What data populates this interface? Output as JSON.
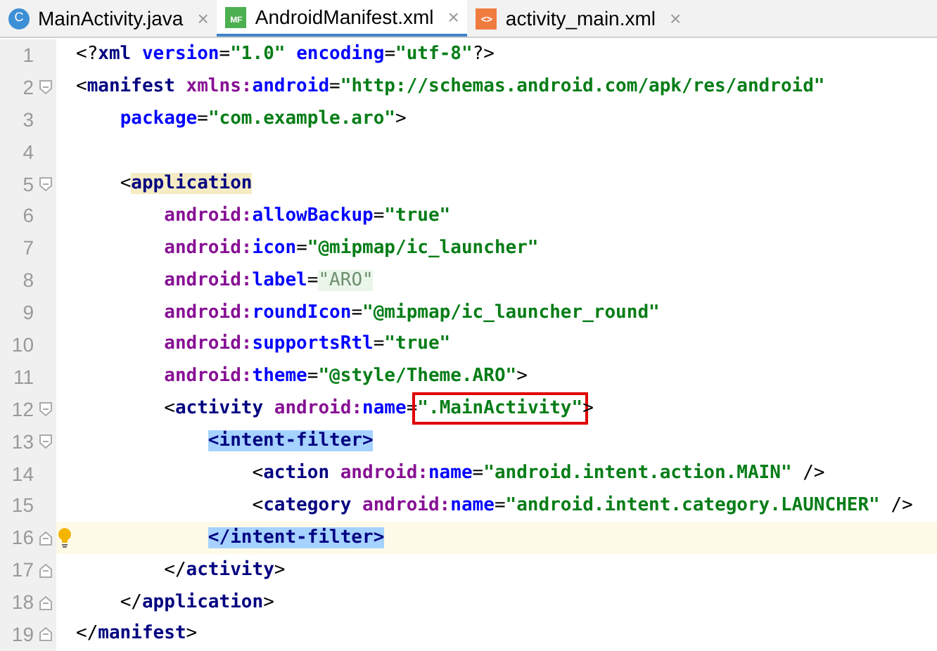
{
  "tabs": [
    {
      "label": "MainActivity.java",
      "selected": false,
      "icon": {
        "kind": "class",
        "glyph": "C"
      },
      "close": "×"
    },
    {
      "label": "AndroidManifest.xml",
      "selected": true,
      "icon": {
        "kind": "manifest",
        "glyph": "MF"
      },
      "close": "×"
    },
    {
      "label": "activity_main.xml",
      "selected": false,
      "icon": {
        "kind": "layout",
        "glyph": "<>"
      },
      "close": "×"
    }
  ],
  "lines": [
    {
      "number": "1",
      "tokens": [
        {
          "kind": "punct",
          "text": "<?"
        },
        {
          "kind": "tag",
          "text": "xml "
        },
        {
          "kind": "attr",
          "text": "version"
        },
        {
          "kind": "punct",
          "text": "="
        },
        {
          "kind": "value",
          "text": "\"1.0\" "
        },
        {
          "kind": "attr",
          "text": "encoding"
        },
        {
          "kind": "punct",
          "text": "="
        },
        {
          "kind": "value",
          "text": "\"utf-8\""
        },
        {
          "kind": "punct",
          "text": "?>"
        }
      ]
    },
    {
      "number": "2",
      "fold_start": true,
      "tokens": [
        {
          "kind": "punct",
          "text": "<"
        },
        {
          "kind": "tag",
          "text": "manifest "
        },
        {
          "kind": "ns",
          "text": "xmlns:"
        },
        {
          "kind": "attr",
          "text": "android"
        },
        {
          "kind": "punct",
          "text": "="
        },
        {
          "kind": "value",
          "text": "\"http://schemas.android.com/apk/res/android\""
        }
      ]
    },
    {
      "number": "3",
      "tokens": [
        {
          "kind": "attr",
          "text": "    package"
        },
        {
          "kind": "punct",
          "text": "="
        },
        {
          "kind": "value",
          "text": "\"com.example.aro\""
        },
        {
          "kind": "punct",
          "text": ">"
        }
      ]
    },
    {
      "number": "4"
    },
    {
      "number": "5",
      "fold_start": true,
      "tokens": [
        {
          "kind": "punct",
          "text": "    <"
        },
        {
          "kind": "tag",
          "text": "application",
          "color": "#f5ecc4"
        }
      ]
    },
    {
      "number": "6",
      "tokens": [
        {
          "kind": "ns",
          "text": "        android:"
        },
        {
          "kind": "attr",
          "text": "allowBackup"
        },
        {
          "kind": "punct",
          "text": "="
        },
        {
          "kind": "value",
          "text": "\"true\""
        }
      ]
    },
    {
      "number": "7",
      "tokens": [
        {
          "kind": "ns",
          "text": "        android:"
        },
        {
          "kind": "attr",
          "text": "icon"
        },
        {
          "kind": "punct",
          "text": "="
        },
        {
          "kind": "value",
          "text": "\"@mipmap/ic_launcher\""
        }
      ]
    },
    {
      "number": "8",
      "tokens": [
        {
          "kind": "ns",
          "text": "        android:"
        },
        {
          "kind": "attr",
          "text": "label"
        },
        {
          "kind": "punct",
          "text": "="
        },
        {
          "kind": "folded",
          "text": "\"ARO\"",
          "color": "#eaf6ea"
        }
      ]
    },
    {
      "number": "9",
      "tokens": [
        {
          "kind": "ns",
          "text": "        android:"
        },
        {
          "kind": "attr",
          "text": "roundIcon"
        },
        {
          "kind": "punct",
          "text": "="
        },
        {
          "kind": "value",
          "text": "\"@mipmap/ic_launcher_round\""
        }
      ]
    },
    {
      "number": "10",
      "tokens": [
        {
          "kind": "ns",
          "text": "        android:"
        },
        {
          "kind": "attr",
          "text": "supportsRtl"
        },
        {
          "kind": "punct",
          "text": "="
        },
        {
          "kind": "value",
          "text": "\"true\""
        }
      ]
    },
    {
      "number": "11",
      "tokens": [
        {
          "kind": "ns",
          "text": "        android:"
        },
        {
          "kind": "attr",
          "text": "theme"
        },
        {
          "kind": "punct",
          "text": "="
        },
        {
          "kind": "value",
          "text": "\"@style/Theme.ARO\""
        },
        {
          "kind": "punct",
          "text": ">"
        }
      ]
    },
    {
      "number": "12",
      "fold_start": true,
      "tokens": [
        {
          "kind": "punct",
          "text": "        <"
        },
        {
          "kind": "tag",
          "text": "activity "
        },
        {
          "kind": "ns",
          "text": "android:"
        },
        {
          "kind": "attr",
          "text": "name"
        },
        {
          "kind": "punct",
          "text": "="
        },
        {
          "kind": "value",
          "text": "\".MainActivity\"",
          "boxed": true
        },
        {
          "kind": "punct",
          "text": ">"
        }
      ]
    },
    {
      "number": "13",
      "fold_start": true,
      "tokens": [
        {
          "kind": "tag",
          "text": "            <intent-filter>",
          "color": "#a6d2ff"
        }
      ]
    },
    {
      "number": "14",
      "tokens": [
        {
          "kind": "punct",
          "text": "                <"
        },
        {
          "kind": "tag",
          "text": "action "
        },
        {
          "kind": "ns",
          "text": "android:"
        },
        {
          "kind": "attr",
          "text": "name"
        },
        {
          "kind": "punct",
          "text": "="
        },
        {
          "kind": "value",
          "text": "\"android.intent.action.MAIN\" "
        },
        {
          "kind": "punct",
          "text": "/>"
        }
      ]
    },
    {
      "number": "15",
      "tokens": [
        {
          "kind": "punct",
          "text": "                <"
        },
        {
          "kind": "tag",
          "text": "category "
        },
        {
          "kind": "ns",
          "text": "android:"
        },
        {
          "kind": "attr",
          "text": "name"
        },
        {
          "kind": "punct",
          "text": "="
        },
        {
          "kind": "value",
          "text": "\"android.intent.category.LAUNCHER\" "
        },
        {
          "kind": "punct",
          "text": "/>"
        }
      ]
    },
    {
      "number": "16",
      "fold_end": true,
      "current": true,
      "bulb": true,
      "tokens": [
        {
          "kind": "tag",
          "text": "            </intent-filter>",
          "color": "#a6d2ff"
        }
      ]
    },
    {
      "number": "17",
      "fold_end": true,
      "tokens": [
        {
          "kind": "punct",
          "text": "        </"
        },
        {
          "kind": "tag",
          "text": "activity"
        },
        {
          "kind": "punct",
          "text": ">"
        }
      ]
    },
    {
      "number": "18",
      "fold_end": true,
      "tokens": [
        {
          "kind": "punct",
          "text": "    </"
        },
        {
          "kind": "tag",
          "text": "application"
        },
        {
          "kind": "punct",
          "text": ">"
        }
      ]
    },
    {
      "number": "19",
      "fold_end": true,
      "tokens": [
        {
          "kind": "punct",
          "text": "</"
        },
        {
          "kind": "tag",
          "text": "manifest"
        },
        {
          "kind": "punct",
          "text": ">"
        }
      ]
    }
  ]
}
